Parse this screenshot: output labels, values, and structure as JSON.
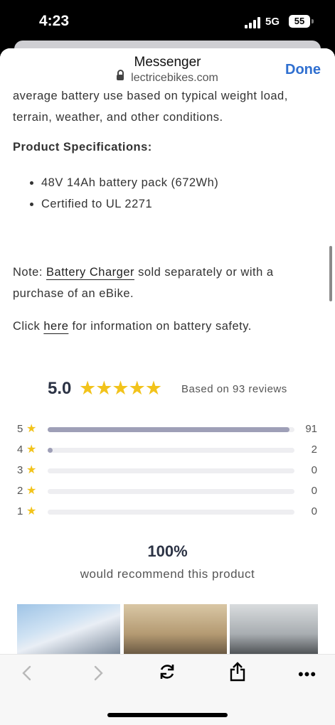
{
  "status_bar": {
    "time": "4:23",
    "network": "5G",
    "battery": "55"
  },
  "header": {
    "app_title": "Messenger",
    "domain": "lectricebikes.com",
    "done_label": "Done"
  },
  "content": {
    "paragraph_cut_line1": "average battery use based on typical weight load,",
    "paragraph_cut_line2": "terrain, weather, and other conditions.",
    "specs_title": "Product Specifications:",
    "specs": [
      "48V 14Ah battery pack (672Wh)",
      "Certified to UL 2271"
    ],
    "note_prefix": "Note: ",
    "note_link": "Battery Charger",
    "note_suffix": " sold separately or with a purchase of an eBike.",
    "click_prefix": "Click ",
    "click_link": "here",
    "click_suffix": " for information on battery safety."
  },
  "reviews": {
    "average": "5.0",
    "stars": "★★★★★",
    "based_on": "Based on 93 reviews",
    "histogram": [
      {
        "stars": "5",
        "count": "91",
        "fraction": 0.98
      },
      {
        "stars": "4",
        "count": "2",
        "fraction": 0.02
      },
      {
        "stars": "3",
        "count": "0",
        "fraction": 0
      },
      {
        "stars": "2",
        "count": "0",
        "fraction": 0
      },
      {
        "stars": "1",
        "count": "0",
        "fraction": 0
      }
    ],
    "recommend_pct": "100%",
    "recommend_text": "would recommend this product"
  },
  "toolbar": {
    "back_icon": "chevron-left",
    "forward_icon": "chevron-right",
    "reload_icon": "reload",
    "share_icon": "share",
    "more_icon": "more-dots"
  },
  "colors": {
    "accent": "#2f6fd0",
    "star": "#f2c31b",
    "bar_fill": "#9e9fb7",
    "bar_track": "#eeeef1"
  }
}
